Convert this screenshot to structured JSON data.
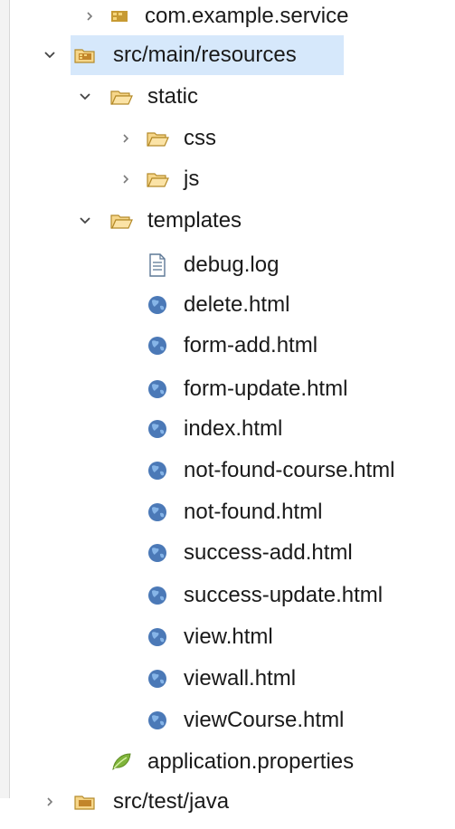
{
  "tree": {
    "rows": [
      {
        "label": "com.example.service",
        "twisty": "collapsed",
        "icon": "package-icon"
      },
      {
        "label": "src/main/resources",
        "twisty": "expanded",
        "icon": "source-folder-icon",
        "selected": true
      },
      {
        "label": "static",
        "twisty": "expanded",
        "icon": "folder-open-icon"
      },
      {
        "label": "css",
        "twisty": "collapsed",
        "icon": "folder-open-icon"
      },
      {
        "label": "js",
        "twisty": "collapsed",
        "icon": "folder-open-icon"
      },
      {
        "label": "templates",
        "twisty": "expanded",
        "icon": "folder-open-icon"
      },
      {
        "label": "debug.log",
        "twisty": "none",
        "icon": "text-file-icon"
      },
      {
        "label": "delete.html",
        "twisty": "none",
        "icon": "html-globe-icon"
      },
      {
        "label": "form-add.html",
        "twisty": "none",
        "icon": "html-globe-icon"
      },
      {
        "label": "form-update.html",
        "twisty": "none",
        "icon": "html-globe-icon"
      },
      {
        "label": "index.html",
        "twisty": "none",
        "icon": "html-globe-icon"
      },
      {
        "label": "not-found-course.html",
        "twisty": "none",
        "icon": "html-globe-icon"
      },
      {
        "label": "not-found.html",
        "twisty": "none",
        "icon": "html-globe-icon"
      },
      {
        "label": "success-add.html",
        "twisty": "none",
        "icon": "html-globe-icon"
      },
      {
        "label": "success-update.html",
        "twisty": "none",
        "icon": "html-globe-icon"
      },
      {
        "label": "view.html",
        "twisty": "none",
        "icon": "html-globe-icon"
      },
      {
        "label": "viewall.html",
        "twisty": "none",
        "icon": "html-globe-icon"
      },
      {
        "label": "viewCourse.html",
        "twisty": "none",
        "icon": "html-globe-icon"
      },
      {
        "label": "application.properties",
        "twisty": "none",
        "icon": "properties-leaf-icon"
      },
      {
        "label": "src/test/java",
        "twisty": "collapsed",
        "icon": "source-folder-icon"
      }
    ]
  },
  "colors": {
    "selection": "#d6e8fb",
    "folder_fill": "#f6d68a",
    "folder_stroke": "#b58b2a",
    "globe_blue": "#4b79b7",
    "leaf_green": "#7fb43a"
  }
}
